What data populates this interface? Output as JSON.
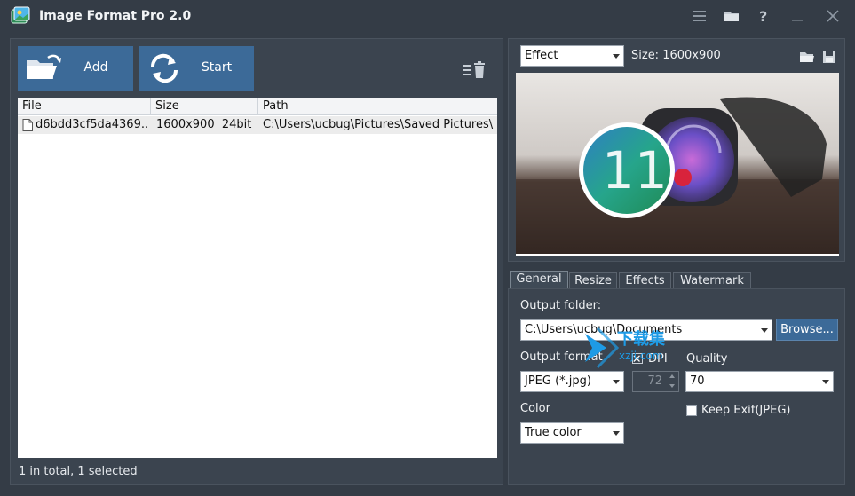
{
  "window": {
    "title": "Image Format Pro 2.0",
    "controls": [
      "menu-icon",
      "folder-icon",
      "help-icon",
      "minimize-icon",
      "close-icon"
    ]
  },
  "toolbar": {
    "add_label": "Add",
    "start_label": "Start"
  },
  "file_list": {
    "columns": [
      "File",
      "Size",
      "Path"
    ],
    "rows": [
      {
        "file": "d6bdd3cf5da4369...",
        "size": "1600x900  24bit",
        "path": "C:\\Users\\ucbug\\Pictures\\Saved Pictures\\"
      }
    ],
    "status": "1 in total, 1 selected"
  },
  "preview": {
    "mode": "Effect",
    "size_label": "Size: 1600x900",
    "badge_text": "11"
  },
  "tabs": [
    {
      "label": "General",
      "active": true
    },
    {
      "label": "Resize",
      "active": false
    },
    {
      "label": "Effects",
      "active": false
    },
    {
      "label": "Watermark",
      "active": false
    }
  ],
  "general": {
    "output_folder_label": "Output folder:",
    "output_folder_value": "C:\\Users\\ucbug\\Documents",
    "browse_label": "Browse...",
    "output_format_label": "Output format",
    "output_format_value": "JPEG (*.jpg)",
    "dpi_label": "DPI",
    "dpi_value": "72",
    "quality_label": "Quality",
    "quality_value": "70",
    "color_label": "Color",
    "color_value": "True color",
    "keep_exif_label": "Keep Exif(JPEG)"
  },
  "watermark_overlay": {
    "line1": "下载集",
    "line2": "xzji.com"
  },
  "colors": {
    "background": "#343c46",
    "panel": "#3b444f",
    "accent": "#3c6a98",
    "watermark_blue": "#1e9be6"
  }
}
